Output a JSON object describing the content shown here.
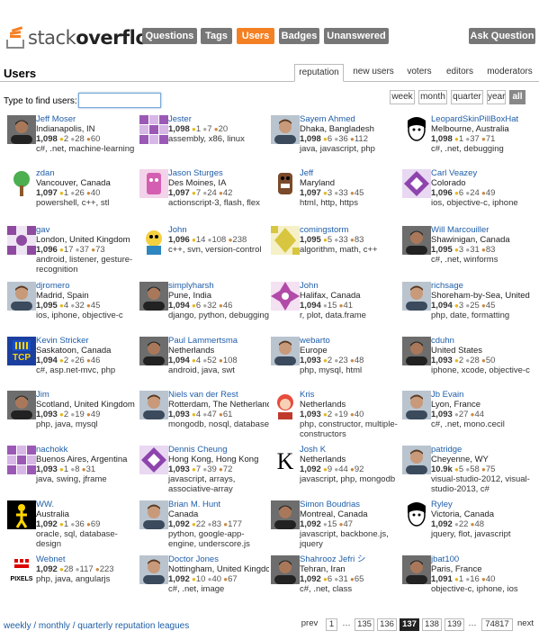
{
  "header": {
    "logo_light": "stack",
    "logo_bold": "overflow",
    "nav": [
      "Questions",
      "Tags",
      "Users",
      "Badges",
      "Unanswered"
    ],
    "ask": "Ask Question",
    "active_color": "#f48024"
  },
  "page": {
    "title": "Users",
    "tabs": [
      "reputation",
      "new users",
      "voters",
      "editors",
      "moderators"
    ],
    "find_label": "Type to find users:",
    "find_value": "",
    "periods": [
      "week",
      "month",
      "quarter",
      "year",
      "all"
    ]
  },
  "users": [
    {
      "name": "Jeff Moser",
      "loc": "Indianapolis, IN",
      "rep": "1,098",
      "g": "2",
      "s": "28",
      "b": "60",
      "tags": "c#, .net, machine-learning",
      "avatar": "photo-man-dark"
    },
    {
      "name": "Jester",
      "loc": "",
      "rep": "1,098",
      "g": "1",
      "s": "7",
      "b": "20",
      "tags": "assembly, x86, linux",
      "avatar": "identicon-purple"
    },
    {
      "name": "Sayem Ahmed",
      "loc": "Dhaka, Bangladesh",
      "rep": "1,098",
      "g": "6",
      "s": "36",
      "b": "112",
      "tags": "java, javascript, php",
      "avatar": "photo-man"
    },
    {
      "name": "LeopardSkinPillBoxHat",
      "loc": "Melbourne, Australia",
      "rep": "1,098",
      "g": "1",
      "s": "37",
      "b": "71",
      "tags": "c#, .net, debugging",
      "avatar": "drawing-face"
    },
    {
      "name": "zdan",
      "loc": "Vancouver, Canada",
      "rep": "1,097",
      "g": "1",
      "s": "26",
      "b": "40",
      "tags": "powershell, c++, stl",
      "avatar": "tree"
    },
    {
      "name": "Jason Sturges",
      "loc": "Des Moines, IA",
      "rep": "1,097",
      "g": "7",
      "s": "24",
      "b": "42",
      "tags": "actionscript-3, flash, flex",
      "avatar": "pink-figure"
    },
    {
      "name": "Jeff",
      "loc": "Maryland",
      "rep": "1,097",
      "g": "3",
      "s": "33",
      "b": "45",
      "tags": "html, http, https",
      "avatar": "domo"
    },
    {
      "name": "Carl Veazey",
      "loc": "Colorado",
      "rep": "1,096",
      "g": "6",
      "s": "24",
      "b": "49",
      "tags": "ios, objective-c, iphone",
      "avatar": "identicon-violet"
    },
    {
      "name": "gav",
      "loc": "London, United Kingdom",
      "rep": "1,096",
      "g": "17",
      "s": "37",
      "b": "73",
      "tags": "android, listener, gesture-recognition",
      "avatar": "identicon-plum"
    },
    {
      "name": "John",
      "loc": "",
      "rep": "1,096",
      "g": "14",
      "s": "108",
      "b": "238",
      "tags": "c++, svn, version-control",
      "avatar": "cartoon"
    },
    {
      "name": "comingstorm",
      "loc": "",
      "rep": "1,095",
      "g": "5",
      "s": "33",
      "b": "83",
      "tags": "algorithm, math, c++",
      "avatar": "identicon-yellow"
    },
    {
      "name": "Will Marcouiller",
      "loc": "Shawinigan, Canada",
      "rep": "1,095",
      "g": "3",
      "s": "31",
      "b": "83",
      "tags": "c#, .net, winforms",
      "avatar": "photo-man-dark"
    },
    {
      "name": "djromero",
      "loc": "Madrid, Spain",
      "rep": "1,095",
      "g": "4",
      "s": "32",
      "b": "45",
      "tags": "ios, iphone, objective-c",
      "avatar": "photo-man"
    },
    {
      "name": "simplyharsh",
      "loc": "Pune, India",
      "rep": "1,094",
      "g": "6",
      "s": "32",
      "b": "46",
      "tags": "django, python, debugging",
      "avatar": "photo-man-dark"
    },
    {
      "name": "John",
      "loc": "Halifax, Canada",
      "rep": "1,094",
      "g": "",
      "s": "15",
      "b": "41",
      "tags": "r, plot, data.frame",
      "avatar": "identicon-magenta"
    },
    {
      "name": "richsage",
      "loc": "Shoreham-by-Sea, United Kingdom",
      "rep": "1,094",
      "g": "3",
      "s": "25",
      "b": "45",
      "tags": "php, date, formatting",
      "avatar": "photo-man"
    },
    {
      "name": "Kevin Stricker",
      "loc": "Saskatoon, Canada",
      "rep": "1,094",
      "g": "2",
      "s": "26",
      "b": "46",
      "tags": "c#, asp.net-mvc, php",
      "avatar": "tcp"
    },
    {
      "name": "Paul Lammertsma",
      "loc": "Netherlands",
      "rep": "1,094",
      "g": "4",
      "s": "52",
      "b": "108",
      "tags": "android, java, swt",
      "avatar": "photo-man-dark"
    },
    {
      "name": "webarto",
      "loc": "Europe",
      "rep": "1,093",
      "g": "2",
      "s": "23",
      "b": "48",
      "tags": "php, mysql, html",
      "avatar": "photo-man"
    },
    {
      "name": "cduhn",
      "loc": "United States",
      "rep": "1,093",
      "g": "2",
      "s": "28",
      "b": "50",
      "tags": "iphone, xcode, objective-c",
      "avatar": "photo-man-dark"
    },
    {
      "name": "Jim",
      "loc": "Scotland, United Kingdom",
      "rep": "1,093",
      "g": "2",
      "s": "19",
      "b": "49",
      "tags": "php, java, mysql",
      "avatar": "photo-man-dark"
    },
    {
      "name": "Niels van der Rest",
      "loc": "Rotterdam, The Netherlands",
      "rep": "1,093",
      "g": "4",
      "s": "47",
      "b": "61",
      "tags": "mongodb, nosql, database",
      "avatar": "photo-man"
    },
    {
      "name": "Kris",
      "loc": "Netherlands",
      "rep": "1,093",
      "g": "2",
      "s": "19",
      "b": "40",
      "tags": "php, constructor, multiple-constructors",
      "avatar": "red-cartoon"
    },
    {
      "name": "Jb Evain",
      "loc": "Lyon, France",
      "rep": "1,093",
      "g": "",
      "s": "27",
      "b": "44",
      "tags": "c#, .net, mono.cecil",
      "avatar": "photo-man"
    },
    {
      "name": "nachokk",
      "loc": "Buenos Aires, Argentina",
      "rep": "1,093",
      "g": "1",
      "s": "8",
      "b": "31",
      "tags": "java, swing, jframe",
      "avatar": "identicon-purple"
    },
    {
      "name": "Dennis Cheung",
      "loc": "Hong Kong, Hong Kong",
      "rep": "1,093",
      "g": "7",
      "s": "39",
      "b": "72",
      "tags": "javascript, arrays, associative-array",
      "avatar": "identicon-violet"
    },
    {
      "name": "Josh K",
      "loc": "Netherlands",
      "rep": "1,092",
      "g": "9",
      "s": "44",
      "b": "92",
      "tags": "javascript, php, mongodb",
      "avatar": "letter-k"
    },
    {
      "name": "patridge",
      "loc": "Cheyenne, WY",
      "rep": "10.9k",
      "g": "5",
      "s": "58",
      "b": "75",
      "tags": "visual-studio-2012, visual-studio-2013, c#",
      "avatar": "photo-man"
    },
    {
      "name": "WW.",
      "loc": "Australia",
      "rep": "1,092",
      "g": "1",
      "s": "36",
      "b": "69",
      "tags": "oracle, sql, database-design",
      "avatar": "yellow-figure"
    },
    {
      "name": "Brian M. Hunt",
      "loc": "Canada",
      "rep": "1,092",
      "g": "22",
      "s": "83",
      "b": "177",
      "tags": "python, google-app-engine, underscore.js",
      "avatar": "photo-man"
    },
    {
      "name": "Simon Boudrias",
      "loc": "Montreal, Canada",
      "rep": "1,092",
      "g": "",
      "s": "15",
      "b": "47",
      "tags": "javascript, backbone.js, jquery",
      "avatar": "photo-man-dark"
    },
    {
      "name": "Ryley",
      "loc": "Victoria, Canada",
      "rep": "1,092",
      "g": "",
      "s": "22",
      "b": "48",
      "tags": "jquery, flot, javascript",
      "avatar": "drawing-face"
    },
    {
      "name": "Webnet",
      "loc": "",
      "rep": "1,092",
      "g": "28",
      "s": "117",
      "b": "223",
      "tags": "php, java, angularjs",
      "avatar": "pixels"
    },
    {
      "name": "Doctor Jones",
      "loc": "Nottingham, United Kingdom",
      "rep": "1,092",
      "g": "10",
      "s": "40",
      "b": "67",
      "tags": "c#, .net, image",
      "avatar": "photo-man"
    },
    {
      "name": "Shahrooz Jefri シ",
      "loc": "Tehran, Iran",
      "rep": "1,092",
      "g": "6",
      "s": "31",
      "b": "65",
      "tags": "c#, .net, class",
      "avatar": "photo-man-dark"
    },
    {
      "name": "jbat100",
      "loc": "Paris, France",
      "rep": "1,091",
      "g": "1",
      "s": "16",
      "b": "40",
      "tags": "objective-c, iphone, ios",
      "avatar": "photo-man-dark"
    }
  ],
  "footer": {
    "leagues": "weekly / monthly / quarterly reputation leagues",
    "prev": "prev",
    "pages": [
      "1",
      "…",
      "135",
      "136",
      "137",
      "138",
      "139",
      "…",
      "74817"
    ],
    "next": "next"
  }
}
